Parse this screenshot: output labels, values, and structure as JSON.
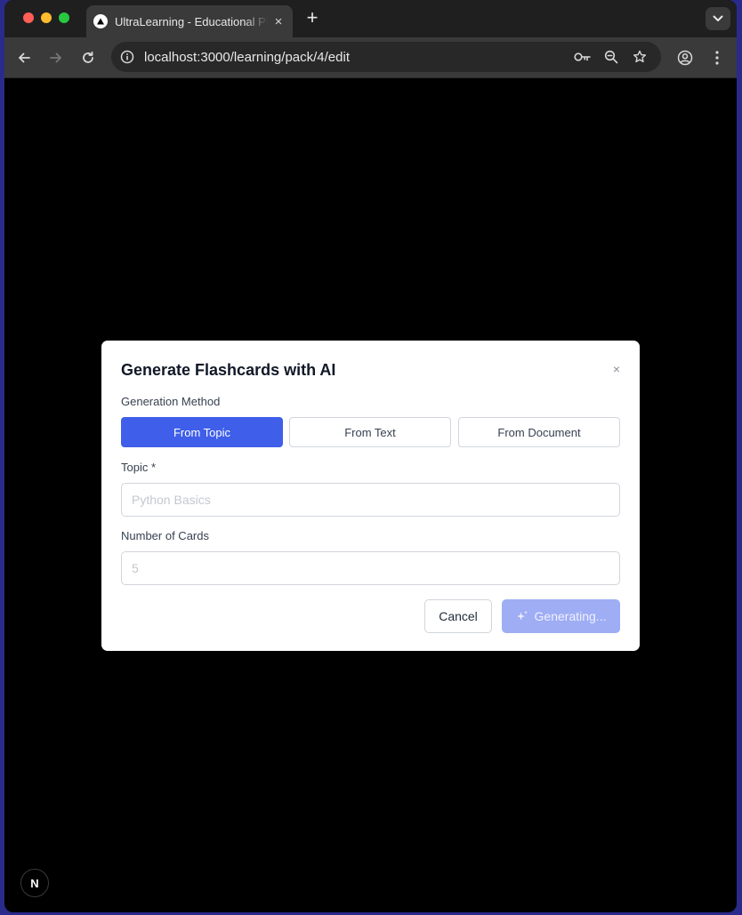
{
  "browser": {
    "tab_title": "UltraLearning - Educational Platform",
    "tab_close": "×",
    "new_tab": "+",
    "url": "localhost:3000/learning/pack/4/edit"
  },
  "modal": {
    "title": "Generate Flashcards with AI",
    "close": "×",
    "method_label": "Generation Method",
    "methods": [
      {
        "label": "From Topic",
        "active": true
      },
      {
        "label": "From Text",
        "active": false
      },
      {
        "label": "From Document",
        "active": false
      }
    ],
    "topic_label": "Topic *",
    "topic_placeholder": "Python Basics",
    "topic_value": "",
    "count_label": "Number of Cards",
    "count_placeholder": "5",
    "count_value": "",
    "cancel_label": "Cancel",
    "generate_label": "Generating..."
  },
  "dev_badge": {
    "label": "N"
  },
  "colors": {
    "accent": "#3f5ee9",
    "accent_disabled": "#9fadf4",
    "backdrop": "#000000"
  }
}
